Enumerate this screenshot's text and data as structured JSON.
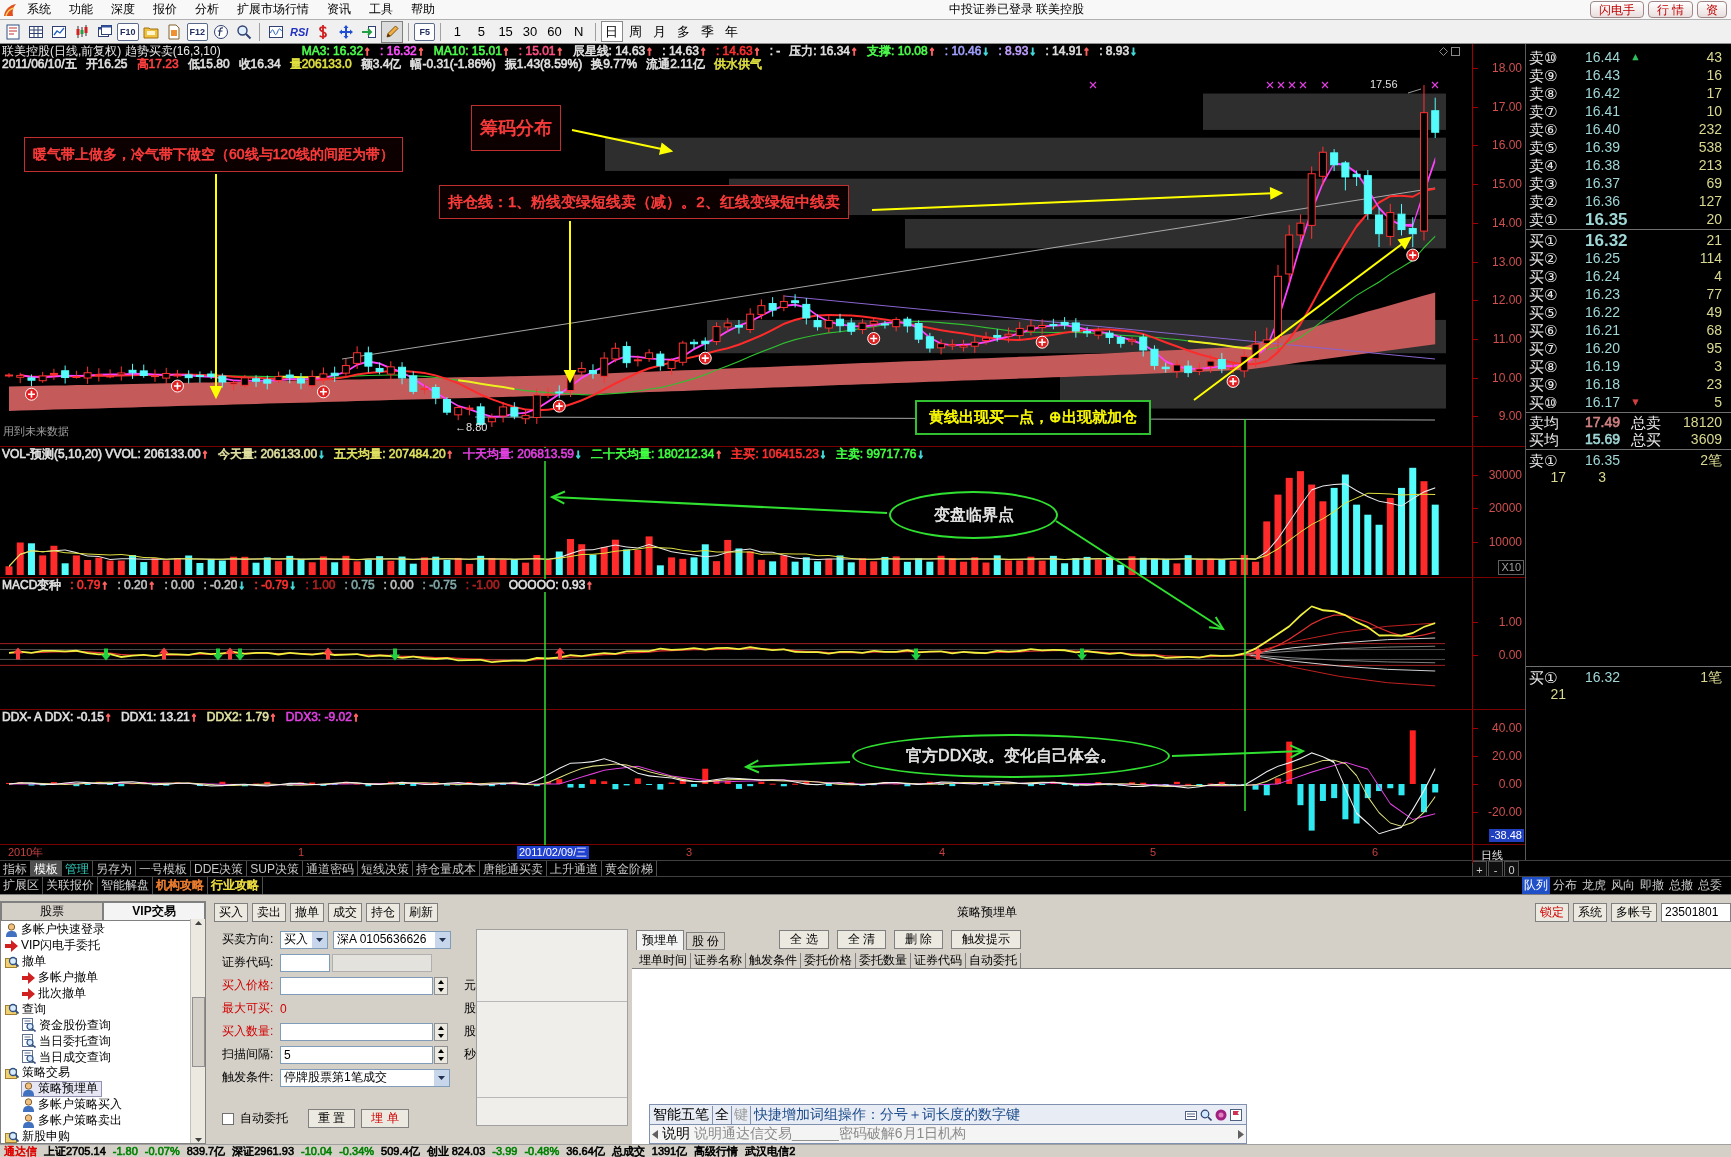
{
  "menu_bar": {
    "items": [
      "系统",
      "功能",
      "深度",
      "报价",
      "分析",
      "扩展市场行情",
      "资讯",
      "工具",
      "帮助"
    ],
    "title": "中投证券已登录 联美控股",
    "buttons": [
      "闪电手",
      "行 情",
      "资"
    ]
  },
  "toolbar": {
    "function_keys": [
      "F10",
      "F12"
    ],
    "indicator": "RSI",
    "refresh_key": "F5",
    "drawing_mode": true,
    "minute_periods": [
      {
        "label": "1",
        "selected": false
      },
      {
        "label": "5",
        "selected": false
      },
      {
        "label": "15",
        "selected": false
      },
      {
        "label": "30",
        "selected": false
      },
      {
        "label": "60",
        "selected": false
      },
      {
        "label": "N",
        "selected": false
      }
    ],
    "day_periods": [
      {
        "label": "日",
        "selected": true
      },
      {
        "label": "周",
        "selected": false
      },
      {
        "label": "月",
        "selected": false
      },
      {
        "label": "多",
        "selected": false
      },
      {
        "label": "季",
        "selected": false
      },
      {
        "label": "年",
        "selected": false
      }
    ]
  },
  "main_chart": {
    "title": "联美控股(日线,前复权) 趋势买卖(16,3,10)",
    "indicators": [
      {
        "text": "MA3: 16.32",
        "color": "#4cff4c",
        "arrow": {
          "text": "↑",
          "color": "#ff6060"
        }
      },
      {
        "text": ": 16.32",
        "color": "#ff50ff",
        "arrow": {
          "text": "↑",
          "color": "#ff6060"
        }
      },
      {
        "text": "MA10: 15.01",
        "color": "#4cff4c",
        "arrow": {
          "text": "↑",
          "color": "#ff6060"
        }
      },
      {
        "text": ": 15.01",
        "color": "#ff5080",
        "arrow": {
          "text": "↑",
          "color": "#ff6060"
        }
      },
      {
        "text": "辰星线: 14.63",
        "color": "#e0e0e0",
        "arrow": {
          "text": "↑",
          "color": "#ff6060"
        }
      },
      {
        "text": ": 14.63",
        "color": "#e0e0e0",
        "arrow": {
          "text": "↑",
          "color": "#ff6060"
        }
      },
      {
        "text": ": 14.63",
        "color": "#ff3030",
        "arrow": {
          "text": "↑",
          "color": "#ff6060"
        }
      },
      {
        "text": ": -",
        "color": "#e0e0e0"
      },
      {
        "text": "压力: 16.34",
        "color": "#e0e0e0",
        "arrow": {
          "text": "↑",
          "color": "#ff6060"
        }
      },
      {
        "text": "支撑: 10.08",
        "color": "#4cff4c",
        "arrow": {
          "text": "↑",
          "color": "#ff6060"
        }
      },
      {
        "text": ": 10.46",
        "color": "#a0a0ff",
        "arrow": {
          "text": "↓",
          "color": "#40d8d8"
        }
      },
      {
        "text": ": 8.93",
        "color": "#c0a0ff",
        "arrow": {
          "text": "↓",
          "color": "#40d8d8"
        }
      },
      {
        "text": ": 14.91",
        "color": "#e0e0e0",
        "arrow": {
          "text": "↑",
          "color": "#ff6060"
        }
      },
      {
        "text": ": 8.93",
        "color": "#e0e0e0",
        "arrow": {
          "text": "↓",
          "color": "#40d8d8"
        }
      }
    ],
    "quote_line": [
      {
        "text": "2011/06/10/五",
        "color": "#e0e0e0"
      },
      {
        "text": "开16.25",
        "color": "#e0e0e0"
      },
      {
        "text": "高17.23",
        "color": "#ff4040"
      },
      {
        "text": "低15.80",
        "color": "#e0e0e0"
      },
      {
        "text": "收16.34",
        "color": "#e0e0e0"
      },
      {
        "text": "量206133.0",
        "color": "#e0e040"
      },
      {
        "text": "额3.4亿",
        "color": "#e0e0e0"
      },
      {
        "text": "幅-0.31(-1.86%)",
        "color": "#e0e0e0"
      },
      {
        "text": "振1.43(8.59%)",
        "color": "#e0e0e0"
      },
      {
        "text": "换9.77%",
        "color": "#e0e0e0"
      },
      {
        "text": "流通2.11亿",
        "color": "#e0e0e0"
      },
      {
        "text": "供水供气",
        "color": "#e0e040"
      }
    ],
    "price_axis": [
      "18.00",
      "17.00",
      "16.00",
      "15.00",
      "14.00",
      "13.00",
      "12.00",
      "11.00",
      "10.00",
      "9.00"
    ],
    "peak_label": "17.56",
    "low_label": "←8.80",
    "note": "用到未来数据"
  },
  "annotations": [
    {
      "kind": "box",
      "text": "暖气带上做多，冷气带下做空（60线与120线的间距为带）",
      "color": "#ff3c3c"
    },
    {
      "kind": "box",
      "text": "筹码分布",
      "color": "#ff3c3c"
    },
    {
      "kind": "box",
      "text": "持仓线：1、粉线变绿短线卖（减）。2、红线变绿短中线卖",
      "color": "#ff3c3c"
    },
    {
      "kind": "callout",
      "text": "黄线出现买一点，⊕出现就加仓",
      "color": "#ffff00"
    },
    {
      "kind": "ellipse",
      "text": "变盘临界点",
      "color": "#e8e8e8"
    },
    {
      "kind": "ellipse",
      "text": "官方DDX改。变化自己体会。",
      "color": "#e8e8e8"
    }
  ],
  "volume_chart": {
    "indicators": [
      {
        "text": "VOL-预测(5,10,20) VVOL: 206133.00",
        "color": "#e0e0e0",
        "arrow": {
          "text": "↑",
          "color": "#ff6060"
        }
      },
      {
        "text": "今天量: 206133.00",
        "color": "#e0e0a0",
        "arrow": {
          "text": "↓",
          "color": "#40d8d8"
        }
      },
      {
        "text": "五天均量: 207484.20",
        "color": "#e0e060",
        "arrow": {
          "text": "↑",
          "color": "#ff6060"
        }
      },
      {
        "text": "十天均量: 206813.59",
        "color": "#e040e0",
        "arrow": {
          "text": "↓",
          "color": "#40d8d8"
        }
      },
      {
        "text": "二十天均量: 180212.34",
        "color": "#40ff40",
        "arrow": {
          "text": "↑",
          "color": "#ff6060"
        }
      },
      {
        "text": "主买: 106415.23",
        "color": "#ff3030",
        "arrow": {
          "text": "↓",
          "color": "#40d8d8"
        }
      },
      {
        "text": "主卖: 99717.76",
        "color": "#40ff40",
        "arrow": {
          "text": "↓",
          "color": "#40d8d8"
        }
      }
    ],
    "axis": [
      "30000",
      "20000",
      "10000"
    ],
    "scale": "X10"
  },
  "macd_chart": {
    "indicators": [
      {
        "text": "MACD变种",
        "color": "#e0e0e0"
      },
      {
        "text": ": 0.79",
        "color": "#ff3030",
        "arrow": {
          "text": "↑",
          "color": "#ff6060"
        }
      },
      {
        "text": ": 0.20",
        "color": "#c0c0c0",
        "arrow": {
          "text": "↑",
          "color": "#ff6060"
        }
      },
      {
        "text": ": 0.00",
        "color": "#c0c0c0"
      },
      {
        "text": ": -0.20",
        "color": "#c0c0c0",
        "arrow": {
          "text": "↓",
          "color": "#40d8d8"
        }
      },
      {
        "text": ": -0.79",
        "color": "#ff3030",
        "arrow": {
          "text": "↓",
          "color": "#40d8d8"
        }
      },
      {
        "text": ": 1.00",
        "color": "#b02020"
      },
      {
        "text": ": 0.75",
        "color": "#80a8a8"
      },
      {
        "text": ": 0.00",
        "color": "#c0c0c0"
      },
      {
        "text": ": -0.75",
        "color": "#80a8a8"
      },
      {
        "text": ": -1.00",
        "color": "#b02020"
      },
      {
        "text": "OOOOO: 0.93",
        "color": "#e0e0e0",
        "arrow": {
          "text": "↑",
          "color": "#ff6060"
        }
      }
    ],
    "axis": [
      "1.00",
      "0.00"
    ]
  },
  "ddx_chart": {
    "indicators": [
      {
        "text": "DDX- A DDX: -0.15",
        "color": "#e0e0e0",
        "arrow": {
          "text": "↑",
          "color": "#ff6060"
        }
      },
      {
        "text": "DDX1: 13.21",
        "color": "#e0e0e0",
        "arrow": {
          "text": "↑",
          "color": "#ff6060"
        }
      },
      {
        "text": "DDX2: 1.79",
        "color": "#e0e0a0",
        "arrow": {
          "text": "↑",
          "color": "#ff6060"
        }
      },
      {
        "text": "DDX3: -9.02",
        "color": "#e040e0",
        "arrow": {
          "text": "↑",
          "color": "#ff6060"
        }
      }
    ],
    "axis": [
      "40.00",
      "20.00",
      "0.00",
      "-20.00"
    ],
    "current_value": "-38.48"
  },
  "time_axis": {
    "labels": [
      {
        "text": "2010年",
        "selected": false
      },
      {
        "text": "1",
        "selected": false
      },
      {
        "text": "2011/02/09/三",
        "selected": true
      },
      {
        "text": "3",
        "selected": false
      },
      {
        "text": "4",
        "selected": false
      },
      {
        "text": "5",
        "selected": false
      },
      {
        "text": "6",
        "selected": false
      }
    ],
    "period": "日线"
  },
  "order_book": {
    "asks": [
      {
        "label": "卖⑩",
        "price": "16.44",
        "volume": "43",
        "marker": {
          "text": "▲",
          "color": "#30c060"
        }
      },
      {
        "label": "卖⑨",
        "price": "16.43",
        "volume": "16"
      },
      {
        "label": "卖⑧",
        "price": "16.42",
        "volume": "17"
      },
      {
        "label": "卖⑦",
        "price": "16.41",
        "volume": "10"
      },
      {
        "label": "卖⑥",
        "price": "16.40",
        "volume": "232"
      },
      {
        "label": "卖⑤",
        "price": "16.39",
        "volume": "538"
      },
      {
        "label": "卖④",
        "price": "16.38",
        "volume": "213"
      },
      {
        "label": "卖③",
        "price": "16.37",
        "volume": "69"
      },
      {
        "label": "卖②",
        "price": "16.36",
        "volume": "127"
      },
      {
        "label": "卖①",
        "price": "16.35",
        "volume": "20"
      }
    ],
    "bids": [
      {
        "label": "买①",
        "price": "16.32",
        "volume": "21"
      },
      {
        "label": "买②",
        "price": "16.25",
        "volume": "114"
      },
      {
        "label": "买③",
        "price": "16.24",
        "volume": "4"
      },
      {
        "label": "买④",
        "price": "16.23",
        "volume": "77"
      },
      {
        "label": "买⑤",
        "price": "16.22",
        "volume": "49"
      },
      {
        "label": "买⑥",
        "price": "16.21",
        "volume": "68"
      },
      {
        "label": "买⑦",
        "price": "16.20",
        "volume": "95"
      },
      {
        "label": "买⑧",
        "price": "16.19",
        "volume": "3"
      },
      {
        "label": "买⑨",
        "price": "16.18",
        "volume": "23"
      },
      {
        "label": "买⑩",
        "price": "16.17",
        "volume": "5",
        "marker": {
          "text": "▼",
          "color": "#d04040"
        }
      }
    ],
    "summary": [
      {
        "label": "卖均",
        "price": "17.49",
        "color": "#d08080",
        "total_label": "总卖",
        "total": "18120"
      },
      {
        "label": "买均",
        "price": "15.69",
        "color": "#9fd6d6",
        "total_label": "总买",
        "total": "3609"
      }
    ],
    "queues": [
      {
        "label": "卖①",
        "price": "16.35",
        "count": "2笔",
        "orders": [
          "17",
          "3"
        ]
      },
      {
        "label": "买①",
        "price": "16.32",
        "count": "1笔",
        "orders": [
          "21"
        ]
      }
    ]
  },
  "template_tabs": [
    {
      "label": "指标",
      "selected": false,
      "highlighted": false
    },
    {
      "label": "模板",
      "selected": true,
      "highlighted": false
    },
    {
      "label": "管理",
      "selected": false,
      "highlighted": true
    },
    {
      "label": "另存为",
      "selected": false,
      "highlighted": false
    },
    {
      "label": "一号模板",
      "selected": false,
      "highlighted": false
    },
    {
      "label": "DDE决策",
      "selected": false,
      "highlighted": false
    },
    {
      "label": "SUP决策",
      "selected": false,
      "highlighted": false
    },
    {
      "label": "通道密码",
      "selected": false,
      "highlighted": false
    },
    {
      "label": "短线决策",
      "selected": false,
      "highlighted": false
    },
    {
      "label": "持仓量成本",
      "selected": false,
      "highlighted": false
    },
    {
      "label": "唐能通买卖",
      "selected": false,
      "highlighted": false
    },
    {
      "label": "上升通道",
      "selected": false,
      "highlighted": false
    },
    {
      "label": "黄金阶梯",
      "selected": false,
      "highlighted": false
    }
  ],
  "zoom_buttons": [
    "+",
    "-",
    "0"
  ],
  "extension_tabs": [
    {
      "label": "扩展区"
    },
    {
      "label": "关联报价"
    },
    {
      "label": "智能解盘"
    },
    {
      "label": "机构攻略",
      "color": "#f08030"
    },
    {
      "label": "行业攻略",
      "color": "#f0e040"
    }
  ],
  "side_tabs": [
    {
      "label": "队列",
      "selected": true
    },
    {
      "label": "分布",
      "selected": false
    },
    {
      "label": "龙虎",
      "selected": false
    },
    {
      "label": "风向",
      "selected": false
    },
    {
      "label": "即撤",
      "selected": false
    },
    {
      "label": "总撤",
      "selected": false
    },
    {
      "label": "总委",
      "selected": false
    }
  ],
  "trade_panel": {
    "tree_tabs": [
      {
        "label": "股票",
        "selected": false
      },
      {
        "label": "VIP交易",
        "selected": true
      }
    ],
    "tree": [
      {
        "label": "多帐户快速登录",
        "kind": "account",
        "selected": false
      },
      {
        "label": "VIP闪电手委托",
        "kind": "order",
        "selected": false
      },
      {
        "label": "撤单",
        "kind": "folder",
        "selected": false,
        "children": [
          {
            "label": "多帐户撤单",
            "kind": "order",
            "selected": false
          },
          {
            "label": "批次撤单",
            "kind": "order",
            "selected": false
          }
        ]
      },
      {
        "label": "查询",
        "kind": "folder",
        "selected": false,
        "children": [
          {
            "label": "资金股份查询",
            "kind": "query",
            "selected": false
          },
          {
            "label": "当日委托查询",
            "kind": "query",
            "selected": false
          },
          {
            "label": "当日成交查询",
            "kind": "query",
            "selected": false
          }
        ]
      },
      {
        "label": "策略交易",
        "kind": "folder",
        "selected": false,
        "children": [
          {
            "label": "策略预埋单",
            "kind": "account",
            "selected": true
          },
          {
            "label": "多帐户策略买入",
            "kind": "account",
            "selected": false
          },
          {
            "label": "多帐户策略卖出",
            "kind": "account",
            "selected": false
          }
        ]
      },
      {
        "label": "新股申购",
        "kind": "folder",
        "selected": false
      }
    ],
    "actions": [
      "买入",
      "卖出",
      "撤单",
      "成交",
      "持仓",
      "刷新"
    ],
    "title": "策略预埋单",
    "header_buttons": [
      {
        "label": "锁定",
        "kind": "alert"
      },
      {
        "label": "系统",
        "kind": "normal"
      },
      {
        "label": "多帐号",
        "kind": "normal"
      }
    ],
    "account_id": "23501801",
    "form": {
      "fields": [
        {
          "label": "买卖方向:",
          "kind": "direction",
          "value": "买入",
          "account": "深A  0105636626",
          "highlighted": false
        },
        {
          "label": "证券代码:",
          "kind": "code",
          "highlighted": false
        },
        {
          "label": "买入价格:",
          "kind": "spin",
          "unit": "元",
          "highlighted": true
        },
        {
          "label": "最大可买:",
          "kind": "readout",
          "value": "0",
          "unit": "股",
          "highlighted": true
        },
        {
          "label": "买入数量:",
          "kind": "spin",
          "unit": "股",
          "highlighted": true
        },
        {
          "label": "扫描间隔:",
          "kind": "spin",
          "value": "5",
          "unit": "秒",
          "highlighted": false
        },
        {
          "label": "触发条件:",
          "kind": "select",
          "value": "停牌股票第1笔成交",
          "highlighted": false
        }
      ],
      "auto_order": {
        "label": "自动委托",
        "checked": false
      },
      "buttons": [
        {
          "label": "重 置",
          "kind": "normal"
        },
        {
          "label": "埋 单",
          "kind": "primary"
        }
      ]
    },
    "order_tabs": [
      {
        "label": "预埋单",
        "selected": true
      },
      {
        "label": "股 份",
        "selected": false
      }
    ],
    "order_buttons": [
      "全 选",
      "全 清",
      "删 除",
      "触发提示"
    ],
    "columns": [
      "埋单时间",
      "证券名称",
      "触发条件",
      "委托价格",
      "委托数量",
      "证券代码",
      "自动委托"
    ]
  },
  "ime_bar": {
    "name": "智能五笔",
    "mode": "全",
    "key": "键",
    "tip": "快捷增加词组操作：分号＋词长度的数字键",
    "label": "说明",
    "candidates": "说明通达信交易______密码破解6月1日机构"
  },
  "status_bar": [
    {
      "text": "通达信",
      "color": "#e00000"
    },
    {
      "text": "上证2705.14",
      "color": "#000000"
    },
    {
      "text": "-1.80",
      "color": "#008000"
    },
    {
      "text": "-0.07%",
      "color": "#008000"
    },
    {
      "text": "839.7亿",
      "color": "#000000"
    },
    {
      "text": "深证2961.93",
      "color": "#000000"
    },
    {
      "text": "-10.04",
      "color": "#008000"
    },
    {
      "text": "-0.34%",
      "color": "#008000"
    },
    {
      "text": "509.4亿",
      "color": "#000000"
    },
    {
      "text": "创业 824.03",
      "color": "#000000"
    },
    {
      "text": "-3.99",
      "color": "#008000"
    },
    {
      "text": "-0.48%",
      "color": "#008000"
    },
    {
      "text": "36.64亿",
      "color": "#000000"
    },
    {
      "text": "总成交",
      "color": "#000000"
    },
    {
      "text": "1391亿",
      "color": "#000000"
    },
    {
      "text": "高级行情",
      "color": "#000000"
    },
    {
      "text": "武汉电信2",
      "color": "#000000"
    }
  ]
}
